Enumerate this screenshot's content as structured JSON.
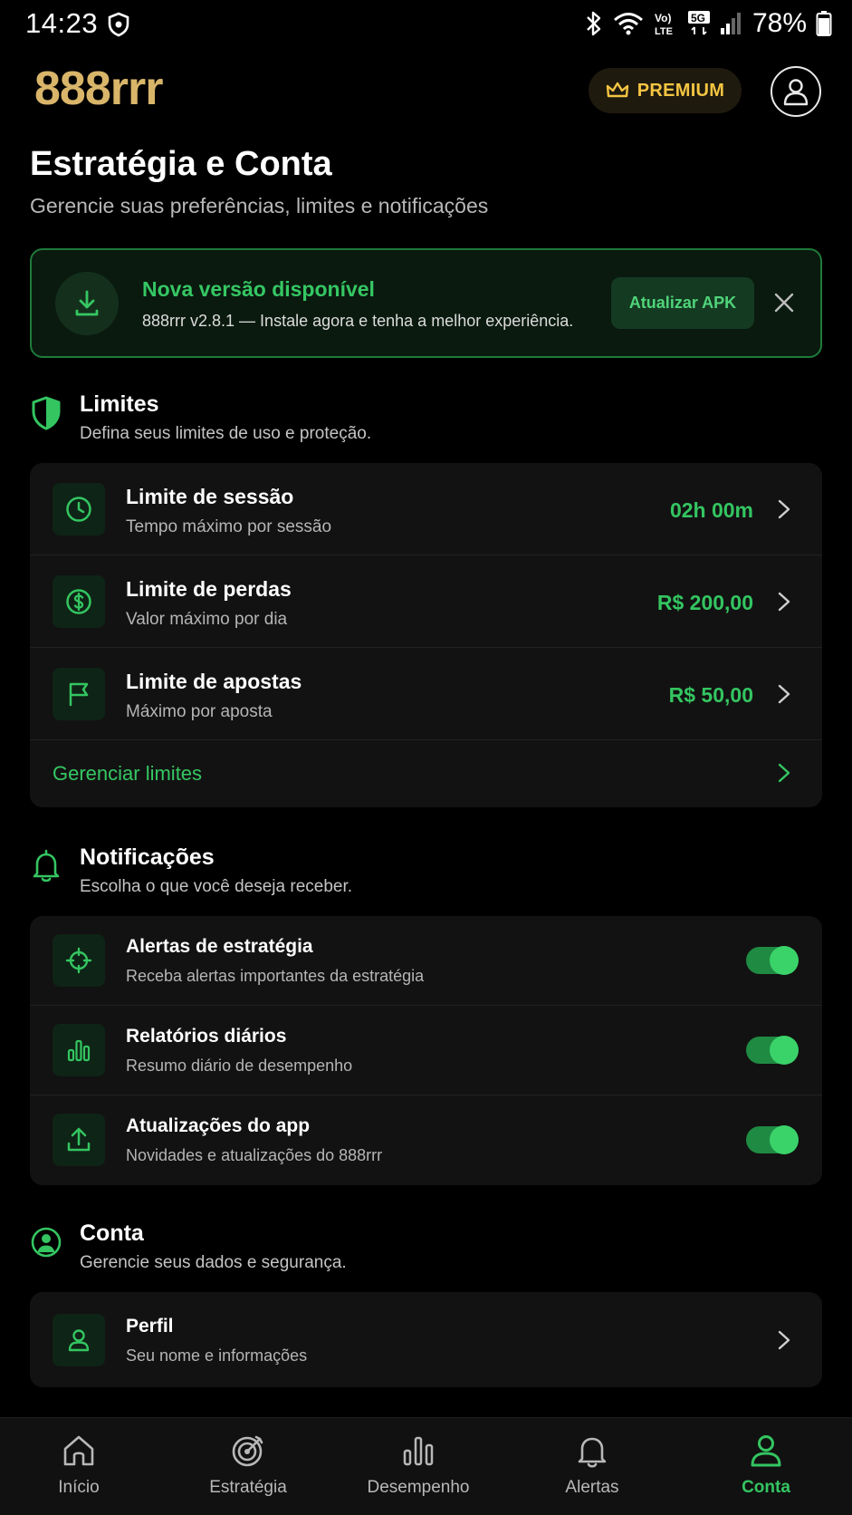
{
  "status_bar": {
    "time": "14:23",
    "network_label": "5G",
    "battery": "78%"
  },
  "header": {
    "logo": "888rrr",
    "premium_label": "PREMIUM"
  },
  "page": {
    "title": "Estratégia e Conta",
    "subtitle": "Gerencie suas preferências, limites e notificações"
  },
  "banner": {
    "title": "Nova versão disponível",
    "text": "888rrr v2.8.1 — Instale agora e tenha a melhor experiência.",
    "button": "Atualizar APK"
  },
  "limits": {
    "title": "Limites",
    "subtitle": "Defina seus limites de uso e proteção.",
    "items": [
      {
        "icon": "clock-icon",
        "title": "Limite de sessão",
        "subtitle": "Tempo máximo por sessão",
        "value": "02h 00m"
      },
      {
        "icon": "dollar-icon",
        "title": "Limite de perdas",
        "subtitle": "Valor máximo por dia",
        "value": "R$ 200,00"
      },
      {
        "icon": "flag-icon",
        "title": "Limite de apostas",
        "subtitle": "Máximo por aposta",
        "value": "R$ 50,00"
      }
    ],
    "manage_label": "Gerenciar limites"
  },
  "notifications": {
    "title": "Notificações",
    "subtitle": "Escolha o que você deseja receber.",
    "items": [
      {
        "icon": "crosshair-icon",
        "title": "Alertas de estratégia",
        "subtitle": "Receba alertas importantes da estratégia",
        "enabled": true
      },
      {
        "icon": "bar-chart-icon",
        "title": "Relatórios diários",
        "subtitle": "Resumo diário de desempenho",
        "enabled": true
      },
      {
        "icon": "upload-icon",
        "title": "Atualizações do app",
        "subtitle": "Novidades e atualizações do 888rrr",
        "enabled": true
      }
    ]
  },
  "account": {
    "title": "Conta",
    "subtitle": "Gerencie seus dados e segurança.",
    "items": [
      {
        "icon": "user-icon",
        "title": "Perfil",
        "subtitle": "Seu nome e informações"
      }
    ]
  },
  "bottom_nav": {
    "items": [
      {
        "icon": "home-icon",
        "label": "Início",
        "active": false
      },
      {
        "icon": "target-icon",
        "label": "Estratégia",
        "active": false
      },
      {
        "icon": "bar-chart-icon",
        "label": "Desempenho",
        "active": false
      },
      {
        "icon": "bell-icon",
        "label": "Alertas",
        "active": false
      },
      {
        "icon": "user-icon",
        "label": "Conta",
        "active": true
      }
    ]
  },
  "colors": {
    "accent_green": "#34c561",
    "logo_gold": "#d9b56a",
    "premium_yellow": "#f4c542",
    "background": "#000000",
    "card": "#121212"
  }
}
